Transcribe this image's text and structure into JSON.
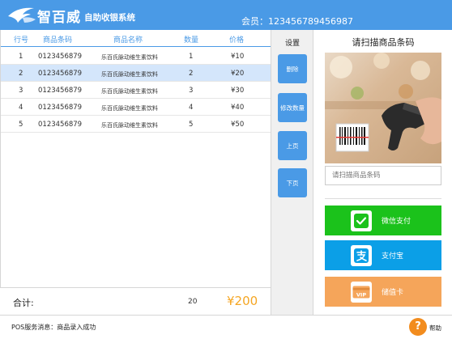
{
  "header": {
    "brand": "智百威",
    "system_name": "自助收银系统",
    "member_text": "会员：123456789456987"
  },
  "table": {
    "headers": [
      "行号",
      "商品条码",
      "商品名称",
      "数量",
      "价格"
    ],
    "rows": [
      {
        "no": "1",
        "barcode": "0123456879",
        "name": "乐百氏脉动维生素饮料",
        "qty": "1",
        "price": "¥10"
      },
      {
        "no": "2",
        "barcode": "0123456879",
        "name": "乐百氏脉动维生素饮料",
        "qty": "2",
        "price": "¥20"
      },
      {
        "no": "3",
        "barcode": "0123456879",
        "name": "乐百氏脉动维生素饮料",
        "qty": "3",
        "price": "¥30"
      },
      {
        "no": "4",
        "barcode": "0123456879",
        "name": "乐百氏脉动维生素饮料",
        "qty": "4",
        "price": "¥40"
      },
      {
        "no": "5",
        "barcode": "0123456879",
        "name": "乐百氏脉动维生素饮料",
        "qty": "5",
        "price": "¥50"
      }
    ],
    "selected_row": 2
  },
  "total": {
    "label": "合计:",
    "qty": "20",
    "amount": "¥200"
  },
  "settings": {
    "title": "设置",
    "buttons": [
      "删除",
      "修改数量",
      "上页",
      "下页"
    ]
  },
  "scan": {
    "title": "请扫描商品条码",
    "placeholder": "请扫描商品条码"
  },
  "payments": {
    "wechat": "微信支付",
    "alipay": "支付宝",
    "card": "储值卡",
    "card_icon_text": "VIP"
  },
  "status": {
    "message": "POS服务消息：商品录入成功",
    "help_label": "帮助"
  },
  "colors": {
    "primary": "#4a9ae6",
    "wechat": "#1bc21b",
    "alipay": "#0b9fe7",
    "card": "#f5a55a",
    "total_amount": "#f5a623",
    "help": "#f28c1e",
    "selected_row": "#d4e6fb"
  },
  "icons": {
    "logo": "zhibaiwei-logo",
    "wechat": "wechat-icon",
    "alipay": "alipay-icon",
    "card": "vip-card-icon",
    "help": "question-icon"
  }
}
